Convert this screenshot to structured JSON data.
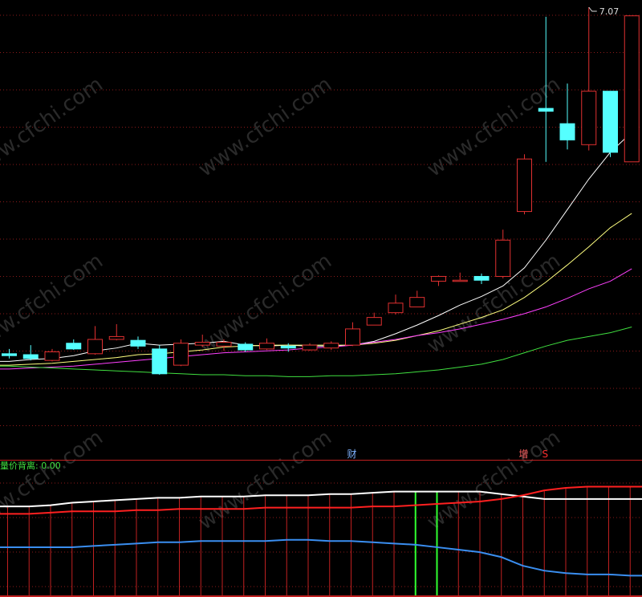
{
  "chart_data": {
    "type": "candlestick",
    "watermark": "www.cfchi.com",
    "main_panel": {
      "max_price_label": "7.07",
      "max_price": 7.07,
      "colors": {
        "up": "#e03030",
        "down": "#55ffff",
        "grid": "#8b1a1a"
      },
      "candles": [
        {
          "o": 3.44,
          "c": 3.42,
          "h": 3.49,
          "l": 3.39
        },
        {
          "o": 3.43,
          "c": 3.39,
          "h": 3.53,
          "l": 3.37
        },
        {
          "o": 3.37,
          "c": 3.46,
          "h": 3.49,
          "l": 3.36
        },
        {
          "o": 3.55,
          "c": 3.49,
          "h": 3.59,
          "l": 3.48
        },
        {
          "o": 3.44,
          "c": 3.59,
          "h": 3.73,
          "l": 3.43
        },
        {
          "o": 3.59,
          "c": 3.62,
          "h": 3.75,
          "l": 3.58
        },
        {
          "o": 3.58,
          "c": 3.52,
          "h": 3.62,
          "l": 3.49
        },
        {
          "o": 3.49,
          "c": 3.23,
          "h": 3.53,
          "l": 3.22
        },
        {
          "o": 3.32,
          "c": 3.55,
          "h": 3.59,
          "l": 3.31
        },
        {
          "o": 3.53,
          "c": 3.56,
          "h": 3.64,
          "l": 3.51
        },
        {
          "o": 3.52,
          "c": 3.56,
          "h": 3.59,
          "l": 3.47
        },
        {
          "o": 3.54,
          "c": 3.48,
          "h": 3.56,
          "l": 3.46
        },
        {
          "o": 3.49,
          "c": 3.55,
          "h": 3.6,
          "l": 3.48
        },
        {
          "o": 3.52,
          "c": 3.5,
          "h": 3.55,
          "l": 3.46
        },
        {
          "o": 3.48,
          "c": 3.53,
          "h": 3.55,
          "l": 3.47
        },
        {
          "o": 3.5,
          "c": 3.55,
          "h": 3.57,
          "l": 3.48
        },
        {
          "o": 3.53,
          "c": 3.7,
          "h": 3.77,
          "l": 3.52
        },
        {
          "o": 3.74,
          "c": 3.82,
          "h": 3.87,
          "l": 3.74
        },
        {
          "o": 3.87,
          "c": 3.97,
          "h": 4.06,
          "l": 3.85
        },
        {
          "o": 3.93,
          "c": 4.03,
          "h": 4.1,
          "l": 3.93
        },
        {
          "o": 4.2,
          "c": 4.25,
          "h": 4.26,
          "l": 4.15
        },
        {
          "o": 4.21,
          "c": 4.21,
          "h": 4.29,
          "l": 4.21
        },
        {
          "o": 4.25,
          "c": 4.21,
          "h": 4.28,
          "l": 4.17
        },
        {
          "o": 4.25,
          "c": 4.63,
          "h": 4.74,
          "l": 4.23
        },
        {
          "o": 4.93,
          "c": 5.48,
          "h": 5.53,
          "l": 4.9
        },
        {
          "o": 6.01,
          "c": 5.98,
          "h": 6.97,
          "l": 5.45
        },
        {
          "o": 5.85,
          "c": 5.68,
          "h": 6.27,
          "l": 5.58
        },
        {
          "o": 5.63,
          "c": 6.19,
          "h": 7.07,
          "l": 5.57
        },
        {
          "o": 6.19,
          "c": 5.55,
          "h": 6.1,
          "l": 5.5
        },
        {
          "o": 5.45,
          "c": 6.98,
          "h": 6.98,
          "l": 5.45
        }
      ],
      "ma_lines": [
        {
          "name": "MA5",
          "color": "#ffffff",
          "values": [
            3.36,
            3.38,
            3.39,
            3.42,
            3.47,
            3.5,
            3.55,
            3.53,
            3.54,
            3.55,
            3.57,
            3.53,
            3.52,
            3.53,
            3.52,
            3.52,
            3.53,
            3.57,
            3.65,
            3.74,
            3.84,
            3.95,
            4.04,
            4.15,
            4.34,
            4.63,
            4.95,
            5.27,
            5.55,
            5.76
          ]
        },
        {
          "name": "MA10",
          "color": "#ffff80",
          "values": [
            3.32,
            3.33,
            3.34,
            3.36,
            3.38,
            3.4,
            3.43,
            3.44,
            3.46,
            3.48,
            3.51,
            3.52,
            3.53,
            3.53,
            3.53,
            3.53,
            3.53,
            3.55,
            3.58,
            3.63,
            3.68,
            3.75,
            3.82,
            3.9,
            4.03,
            4.19,
            4.37,
            4.56,
            4.76,
            4.91
          ]
        },
        {
          "name": "MA30",
          "color": "#ff40ff",
          "values": [
            3.28,
            3.29,
            3.3,
            3.31,
            3.33,
            3.35,
            3.37,
            3.39,
            3.41,
            3.43,
            3.45,
            3.46,
            3.47,
            3.48,
            3.5,
            3.51,
            3.53,
            3.56,
            3.59,
            3.63,
            3.66,
            3.7,
            3.75,
            3.8,
            3.86,
            3.93,
            4.02,
            4.12,
            4.2,
            4.33
          ]
        },
        {
          "name": "MA60",
          "color": "#40e040",
          "values": [
            3.31,
            3.3,
            3.29,
            3.28,
            3.27,
            3.26,
            3.25,
            3.24,
            3.23,
            3.22,
            3.22,
            3.21,
            3.21,
            3.2,
            3.2,
            3.21,
            3.21,
            3.22,
            3.23,
            3.25,
            3.27,
            3.3,
            3.33,
            3.38,
            3.45,
            3.52,
            3.58,
            3.62,
            3.66,
            3.72
          ]
        }
      ]
    },
    "indicator_panel": {
      "title": "量价背离: 0.00",
      "title_color": "#40e040",
      "value": 0.0,
      "markers": [
        {
          "text": "财",
          "color": "#7fb2ff",
          "bar_index": 16
        },
        {
          "text": "增",
          "color": "#ff6060",
          "bar_index": 24
        },
        {
          "text": "S",
          "color": "#ff3030",
          "bar_index": 25
        }
      ],
      "green_bar_indices": [
        19,
        20
      ],
      "series": [
        {
          "name": "white",
          "color": "#ffffff",
          "values": [
            0.72,
            0.72,
            0.73,
            0.75,
            0.76,
            0.77,
            0.78,
            0.79,
            0.79,
            0.8,
            0.8,
            0.8,
            0.81,
            0.81,
            0.81,
            0.82,
            0.82,
            0.83,
            0.84,
            0.84,
            0.84,
            0.84,
            0.84,
            0.82,
            0.8,
            0.78,
            0.78,
            0.78,
            0.78,
            0.78
          ]
        },
        {
          "name": "red",
          "color": "#ff2020",
          "values": [
            0.66,
            0.66,
            0.67,
            0.68,
            0.68,
            0.68,
            0.69,
            0.69,
            0.7,
            0.7,
            0.7,
            0.7,
            0.71,
            0.71,
            0.71,
            0.71,
            0.71,
            0.72,
            0.72,
            0.73,
            0.74,
            0.75,
            0.76,
            0.78,
            0.81,
            0.85,
            0.87,
            0.88,
            0.88,
            0.88
          ]
        },
        {
          "name": "blue",
          "color": "#3a8ef0",
          "values": [
            0.39,
            0.39,
            0.39,
            0.39,
            0.4,
            0.41,
            0.42,
            0.43,
            0.43,
            0.44,
            0.44,
            0.44,
            0.44,
            0.45,
            0.45,
            0.44,
            0.44,
            0.43,
            0.42,
            0.41,
            0.39,
            0.37,
            0.35,
            0.31,
            0.24,
            0.2,
            0.18,
            0.17,
            0.17,
            0.16
          ]
        }
      ]
    }
  }
}
